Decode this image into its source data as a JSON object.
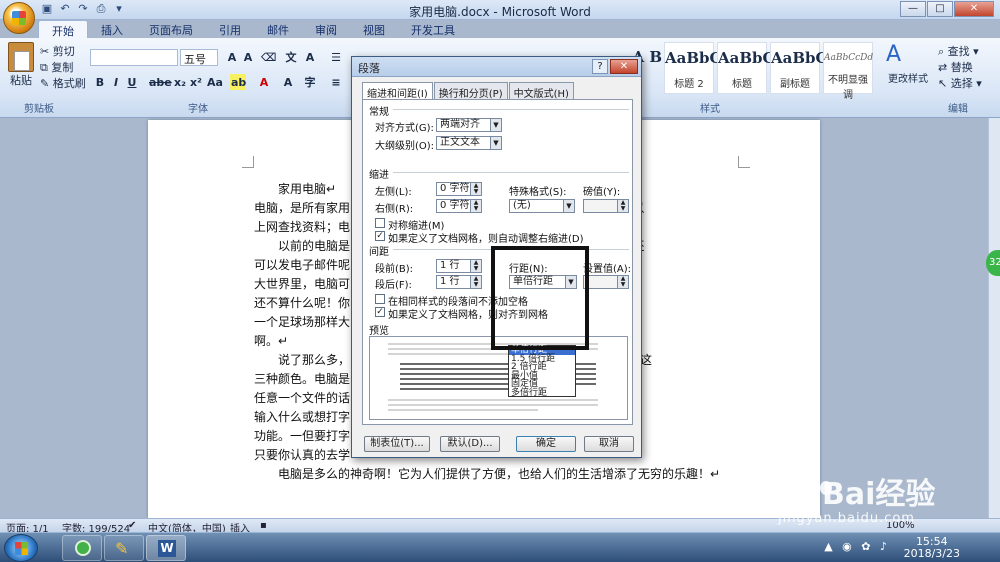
{
  "window": {
    "title": "家用电脑.docx - Microsoft Word",
    "controls": {
      "minimize": "—",
      "maximize": "□",
      "close": "✕"
    }
  },
  "ribbon": {
    "tabs": [
      "开始",
      "插入",
      "页面布局",
      "引用",
      "邮件",
      "审阅",
      "视图",
      "开发工具"
    ],
    "active_tab": "开始",
    "clipboard": {
      "paste": "粘贴",
      "cut": "剪切",
      "copy": "复制",
      "format_painter": "格式刷",
      "label": "剪贴板"
    },
    "font": {
      "size": "五号",
      "label": "字体"
    },
    "paragraph": {
      "label": "段落"
    },
    "styles": {
      "label": "样式",
      "cards": [
        {
          "sample": "AaBbC",
          "caption": "标题 2"
        },
        {
          "sample": "AaBbC",
          "caption": "标题"
        },
        {
          "sample": "AaBbC",
          "caption": "副标题"
        },
        {
          "sample": "AaBbCcDd",
          "caption": "不明显强调"
        }
      ],
      "change_styles": "更改样式"
    },
    "editing": {
      "find": "查找",
      "replace": "替换",
      "select": "选择",
      "label": "编辑"
    }
  },
  "document": {
    "paragraphs": [
      "家用电脑↵",
      "电脑，是所有家用                                                    来娱乐；电脑可以",
      "上网查找资料；电",
      "以前的电脑是                                                    不仅可以上网，还",
      "可以发电子邮件呢                                                  全呢。在当今这个",
      "大世界里，电脑可                                                  多得数不清。这",
      "还不算什么呢！你                                                  一台电脑，竟然有",
      "一个足球场那样大                                                  较，真是天壤之别",
      "啊。↵",
      "说了那么多，                                                      般是银。灰。黑这",
      "三种颜色。电脑是                                                  想打开显示屏上的",
      "任意一个文件的话                                                  文件了；如果你想",
      "输入什么或想打字                                                  符和一些数字还有",
      "功能。一但要打字                                                  那个数字就行了。",
      "只要你认真的去学",
      "电脑是多么的神奇啊！它为人们提供了方便，也给人们的生活增添了无穷的乐趣！↵"
    ]
  },
  "dialog": {
    "title": "段落",
    "help": "?",
    "close": "✕",
    "tabs": [
      "缩进和间距(I)",
      "换行和分页(P)",
      "中文版式(H)"
    ],
    "general": {
      "heading": "常规",
      "alignment_label": "对齐方式(G):",
      "alignment_value": "两端对齐",
      "outline_label": "大纲级别(O):",
      "outline_value": "正文文本"
    },
    "indent": {
      "heading": "缩进",
      "left_label": "左侧(L):",
      "left_value": "0 字符",
      "right_label": "右侧(R):",
      "right_value": "0 字符",
      "special_label": "特殊格式(S):",
      "special_value": "(无)",
      "by_label": "磅值(Y):",
      "mirror_label": "对称缩进(M)",
      "auto_adjust_label": "如果定义了文档网格，则自动调整右缩进(D)"
    },
    "spacing": {
      "heading": "间距",
      "before_label": "段前(B):",
      "before_value": "1 行",
      "after_label": "段后(F):",
      "after_value": "1 行",
      "line_label": "行距(N):",
      "line_value": "单倍行距",
      "at_label": "设置值(A):",
      "no_space_label": "在相同样式的段落间不添加空格",
      "snap_grid_label": "如果定义了文档网格，则对齐到网格",
      "line_options": [
        "单倍行距",
        "1.5 倍行距",
        "2 倍行距",
        "最小值",
        "固定值",
        "多倍行距"
      ],
      "selected_option": "单倍行距"
    },
    "preview_heading": "预览",
    "buttons": {
      "tabs": "制表位(T)...",
      "default": "默认(D)...",
      "ok": "确定",
      "cancel": "取消"
    }
  },
  "status_bar": {
    "page": "页面: 1/1",
    "words": "字数: 199/524",
    "language": "中文(简体，中国)",
    "mode": "插入",
    "zoom": "100%"
  },
  "taskbar": {
    "time": "15:54",
    "date": "2018/3/23"
  },
  "watermark": {
    "brand": "Bai经验",
    "url": "jingyan.baidu.com"
  },
  "side_badge": "32"
}
